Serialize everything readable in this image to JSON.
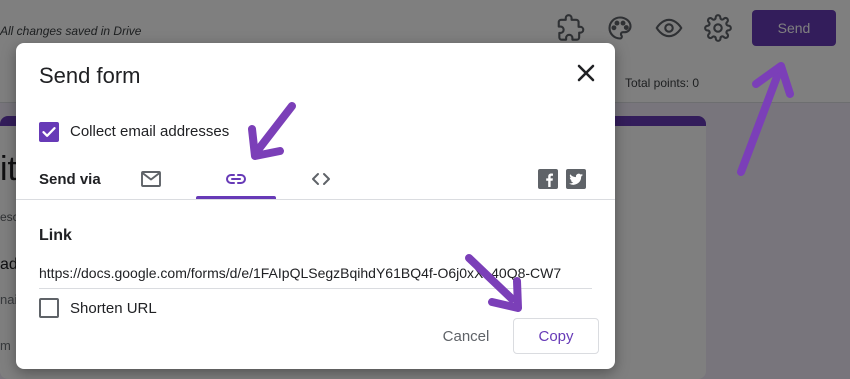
{
  "app": {
    "save_status": "All changes saved in Drive",
    "send_button": "Send",
    "total_points": "Total points: 0",
    "form_title_fragment": "it",
    "form_desc_fragment": "esc",
    "form_line_fragment": "ad",
    "form_line2_fragment": "nai",
    "form_line3_fragment": "m",
    "icons": [
      "addons-icon",
      "palette-icon",
      "preview-eye-icon",
      "settings-gear-icon"
    ]
  },
  "dialog": {
    "title": "Send form",
    "collect_email_label": "Collect email addresses",
    "collect_email_checked": true,
    "send_via_label": "Send via",
    "tabs": [
      {
        "name": "email",
        "icon": "mail-icon",
        "active": false
      },
      {
        "name": "link",
        "icon": "link-icon",
        "active": true
      },
      {
        "name": "embed",
        "icon": "embed-code-icon",
        "active": false
      }
    ],
    "social": [
      "facebook-icon",
      "twitter-icon"
    ],
    "link_section_label": "Link",
    "link_url": "https://docs.google.com/forms/d/e/1FAIpQLSegzBqihdY61BQ4f-O6j0xXL40Q8-CW7",
    "shorten_url_label": "Shorten URL",
    "shorten_url_checked": false,
    "cancel_label": "Cancel",
    "copy_label": "Copy"
  },
  "colors": {
    "accent": "#673ab7",
    "annotation_arrow": "#7b3fb8",
    "text_primary": "#202124",
    "text_secondary": "#5f6368"
  }
}
